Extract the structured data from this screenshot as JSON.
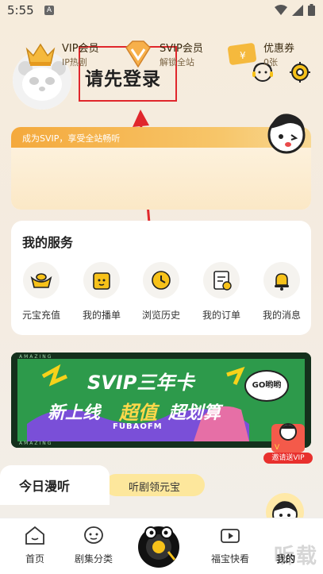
{
  "status_bar": {
    "time": "5:55",
    "notif": "A"
  },
  "header": {
    "login_text": "请先登录"
  },
  "vip": {
    "promo": "成为SVIP，享受全站畅听",
    "items": [
      {
        "title": "VIP会员",
        "sub": "IP热剧"
      },
      {
        "title": "SVIP会员",
        "sub": "解锁全站"
      },
      {
        "title": "优惠券",
        "sub": "0张"
      }
    ]
  },
  "services": {
    "title": "我的服务",
    "items": [
      {
        "label": "元宝充值",
        "icon": "ingot-icon"
      },
      {
        "label": "我的播单",
        "icon": "playlist-icon"
      },
      {
        "label": "浏览历史",
        "icon": "history-icon"
      },
      {
        "label": "我的订单",
        "icon": "order-icon"
      },
      {
        "label": "我的消息",
        "icon": "bell-icon"
      }
    ]
  },
  "banner": {
    "line1": "SVIP三年卡",
    "line2a": "新上线",
    "line2b": "超值",
    "line2c": "超划算",
    "bubble": "GO哟哟",
    "brand": "FUBAOFM",
    "stripe": "AMAZING",
    "invite": "邀请送VIP"
  },
  "today": {
    "tab1": "今日漫听",
    "tab2": "听剧领元宝"
  },
  "nav": {
    "items": [
      {
        "label": "首页",
        "icon": "home-icon"
      },
      {
        "label": "剧集分类",
        "icon": "category-icon"
      },
      {
        "label": "",
        "icon": "player-icon"
      },
      {
        "label": "福宝快看",
        "icon": "video-icon"
      },
      {
        "label": "我的",
        "icon": "profile-icon"
      }
    ]
  },
  "watermark": "听载",
  "colors": {
    "accent": "#f7a940",
    "highlight_box": "#e0272c",
    "yellow": "#ffd84a"
  }
}
